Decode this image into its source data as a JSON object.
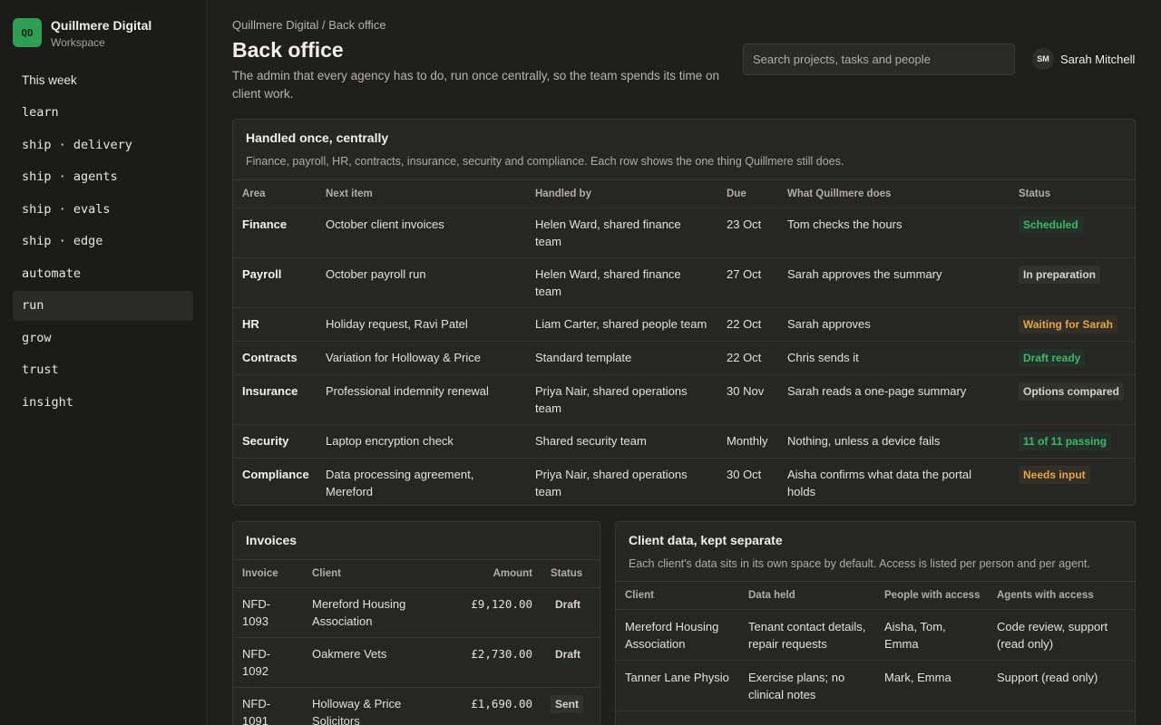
{
  "brand": {
    "logo": "QD",
    "name": "Quillmere Digital",
    "sub": "Workspace"
  },
  "nav": [
    {
      "label": "This week"
    },
    {
      "label": "learn"
    },
    {
      "label": "ship · delivery"
    },
    {
      "label": "ship · agents"
    },
    {
      "label": "ship · evals"
    },
    {
      "label": "ship · edge"
    },
    {
      "label": "automate"
    },
    {
      "label": "run",
      "active": true
    },
    {
      "label": "grow"
    },
    {
      "label": "trust"
    },
    {
      "label": "insight"
    }
  ],
  "header": {
    "breadcrumb": "Quillmere Digital / Back office",
    "title": "Back office",
    "description": "The admin that every agency has to do, run once centrally, so the team spends its time on client work.",
    "search_placeholder": "Search projects, tasks and people",
    "user_initials": "SM",
    "user_name": "Sarah Mitchell"
  },
  "handled": {
    "title": "Handled once, centrally",
    "description": "Finance, payroll, HR, contracts, insurance, security and compliance. Each row shows the one thing Quillmere still does.",
    "columns": [
      "Area",
      "Next item",
      "Handled by",
      "Due",
      "What Quillmere does",
      "Status"
    ],
    "rows": [
      {
        "area": "Finance",
        "next": "October client invoices",
        "by": "Helen Ward, shared finance team",
        "due": "23 Oct",
        "does": "Tom checks the hours",
        "status": "Scheduled",
        "tone": "green"
      },
      {
        "area": "Payroll",
        "next": "October payroll run",
        "by": "Helen Ward, shared finance team",
        "due": "27 Oct",
        "does": "Sarah approves the summary",
        "status": "In preparation",
        "tone": "grey"
      },
      {
        "area": "HR",
        "next": "Holiday request, Ravi Patel",
        "by": "Liam Carter, shared people team",
        "due": "22 Oct",
        "does": "Sarah approves",
        "status": "Waiting for Sarah",
        "tone": "amber"
      },
      {
        "area": "Contracts",
        "next": "Variation for Holloway & Price",
        "by": "Standard template",
        "due": "22 Oct",
        "does": "Chris sends it",
        "status": "Draft ready",
        "tone": "green"
      },
      {
        "area": "Insurance",
        "next": "Professional indemnity renewal",
        "by": "Priya Nair, shared operations team",
        "due": "30 Nov",
        "does": "Sarah reads a one-page summary",
        "status": "Options compared",
        "tone": "grey"
      },
      {
        "area": "Security",
        "next": "Laptop encryption check",
        "by": "Shared security team",
        "due": "Monthly",
        "does": "Nothing, unless a device fails",
        "status": "11 of 11 passing",
        "tone": "green"
      },
      {
        "area": "Compliance",
        "next": "Data processing agreement, Mereford",
        "by": "Priya Nair, shared operations team",
        "due": "30 Oct",
        "does": "Aisha confirms what data the portal holds",
        "status": "Needs input",
        "tone": "amber"
      }
    ]
  },
  "invoices": {
    "title": "Invoices",
    "columns": [
      "Invoice",
      "Client",
      "Amount",
      "Status"
    ],
    "rows": [
      {
        "id": "NFD-1093",
        "client": "Mereford Housing Association",
        "amount": "£9,120.00",
        "status": "Draft"
      },
      {
        "id": "NFD-1092",
        "client": "Oakmere Vets",
        "amount": "£2,730.00",
        "status": "Draft"
      },
      {
        "id": "NFD-1091",
        "client": "Holloway & Price Solicitors",
        "amount": "£1,690.00",
        "status": "Sent"
      }
    ]
  },
  "clientdata": {
    "title": "Client data, kept separate",
    "description": "Each client's data sits in its own space by default. Access is listed per person and per agent.",
    "columns": [
      "Client",
      "Data held",
      "People with access",
      "Agents with access"
    ],
    "rows": [
      {
        "client": "Mereford Housing Association",
        "data": "Tenant contact details, repair requests",
        "people": "Aisha, Tom, Emma",
        "agents": "Code review, support (read only)"
      },
      {
        "client": "Tanner Lane Physio",
        "data": "Exercise plans; no clinical notes",
        "people": "Mark, Emma",
        "agents": "Support (read only)"
      }
    ]
  }
}
